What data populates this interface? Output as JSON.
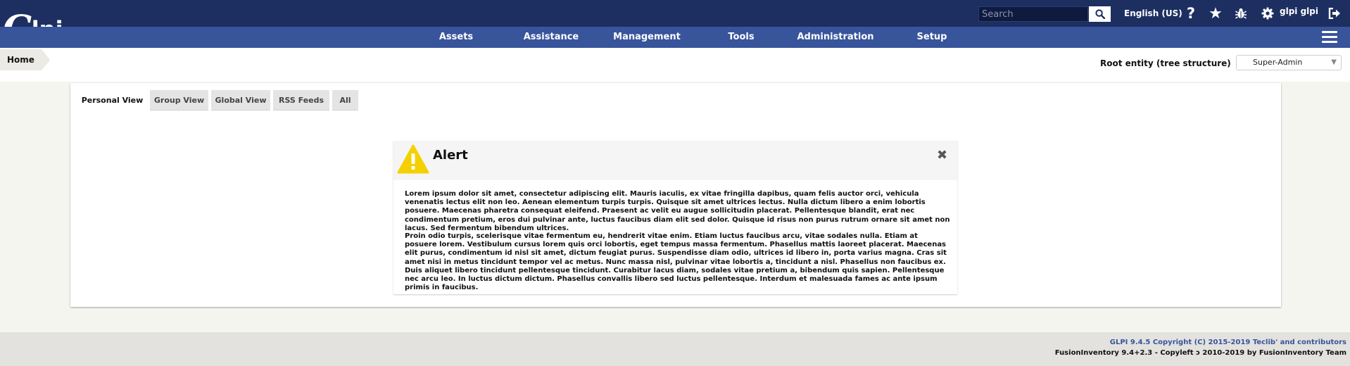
{
  "app": {
    "logo_text": "Glpi",
    "logo_letter": "G",
    "logo_rest": "lpi"
  },
  "header": {
    "search_placeholder": "Search",
    "language": "English (US)",
    "user_name": "glpi glpi",
    "icons": [
      "search-icon",
      "help-icon",
      "star-icon",
      "bug-icon",
      "gear-icon",
      "logout-icon"
    ]
  },
  "menu": {
    "items": [
      {
        "label": "Assets"
      },
      {
        "label": "Assistance"
      },
      {
        "label": "Management"
      },
      {
        "label": "Tools"
      },
      {
        "label": "Administration"
      },
      {
        "label": "Setup"
      }
    ]
  },
  "breadcrumb": {
    "home": "Home"
  },
  "entity": {
    "label": "Root entity (tree structure)",
    "profile": "Super-Admin"
  },
  "tabs": [
    {
      "label": "Personal View",
      "active": true
    },
    {
      "label": "Group View",
      "active": false
    },
    {
      "label": "Global View",
      "active": false
    },
    {
      "label": "RSS Feeds",
      "active": false
    },
    {
      "label": "All",
      "active": false
    }
  ],
  "alert": {
    "title": "Alert",
    "paragraphs": [
      "Lorem ipsum dolor sit amet, consectetur adipiscing elit. Mauris iaculis, ex vitae fringilla dapibus, quam felis auctor orci, vehicula venenatis lectus elit non leo. Aenean elementum turpis turpis. Quisque sit amet ultrices lectus. Nulla dictum libero a enim lobortis posuere. Maecenas pharetra consequat eleifend. Praesent ac velit eu augue sollicitudin placerat. Pellentesque blandit, erat nec condimentum pretium, eros dui pulvinar ante, luctus faucibus diam elit sed dolor. Quisque id risus non purus rutrum ornare sit amet non lacus. Sed fermentum bibendum ultrices.",
      "Proin odio turpis, scelerisque vitae fermentum eu, hendrerit vitae enim. Etiam luctus faucibus arcu, vitae sodales nulla. Etiam at posuere lorem. Vestibulum cursus lorem quis orci lobortis, eget tempus massa fermentum. Phasellus mattis laoreet placerat. Maecenas elit purus, condimentum id nisl sit amet, dictum feugiat purus. Suspendisse diam odio, ultrices id libero in, porta varius magna. Cras sit amet nisi in metus tincidunt tempor vel ac metus. Nunc massa nisl, pulvinar vitae lobortis a, tincidunt a nisl. Phasellus non faucibus ex. Duis aliquet libero tincidunt pellentesque tincidunt. Curabitur lacus diam, sodales vitae pretium a, bibendum quis sapien. Pellentesque nec arcu leo. In luctus dictum dictum. Phasellus convallis libero sed luctus pellentesque. Interdum et malesuada fames ac ante ipsum primis in faucibus."
    ]
  },
  "footer": {
    "glpi_copyright": "GLPI 9.4.5 Copyright (C) 2015-2019 Teclib' and contributors",
    "fusion_copyleft": "FusionInventory 9.4+2.3 - Copyleft ↄ 2010-2019 by FusionInventory Team"
  },
  "colors": {
    "topbar": "#1d2f61",
    "menubar": "#38549b",
    "warning": "#f5d000"
  }
}
